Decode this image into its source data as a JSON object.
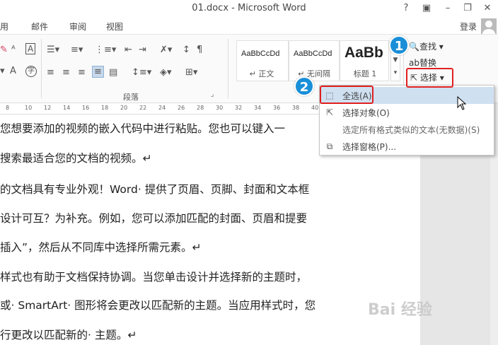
{
  "window": {
    "title": "01.docx - Microsoft Word",
    "help": "?",
    "minimize": "–",
    "close": "✕"
  },
  "menu": {
    "tabs": [
      "用",
      "邮件",
      "审阅",
      "视图"
    ],
    "login": "登录"
  },
  "ribbon": {
    "styles": [
      {
        "sample": "AaBbCcDd",
        "name": "↵ 正文"
      },
      {
        "sample": "AaBbCcDd",
        "name": "↵ 无间隔"
      },
      {
        "sample": "AaBb",
        "name": "标题 1"
      }
    ],
    "paragraph_label": "段落",
    "find_label": "查找",
    "replace_label": "替换",
    "select_label": "选择"
  },
  "ruler": {
    "ticks": [
      "8",
      "10",
      "12",
      "14",
      "16",
      "18",
      "20",
      "22",
      "24",
      "26",
      "28",
      "30",
      "32",
      "34",
      "36",
      "38",
      "40"
    ]
  },
  "document": {
    "lines": [
      "您想要添加的视频的嵌入代码中进行粘贴。您也可以键入一",
      "搜索最适合您的文档的视频。↵",
      "的文档具有专业外观！Word· 提供了页眉、页脚、封面和文本框",
      "设计可互？为补充。例如，您可以添加匹配的封面、页眉和提要",
      "插入”，然后从不同库中选择所需元素。↵",
      "样式也有助于文档保持协调。当您单击设计并选择新的主题时，",
      "或· SmartArt· 图形将会更改以匹配新的主题。当应用样式时，您",
      "行更改以匹配新的· 主题。↵"
    ]
  },
  "dropdown": {
    "items": [
      {
        "icon": "select-all-icon",
        "label": "全选(A)"
      },
      {
        "icon": "select-objects-icon",
        "label": "选择对象(O)"
      },
      {
        "icon": "none",
        "label": "选定所有格式类似的文本(无数据)(S)"
      },
      {
        "icon": "selection-pane-icon",
        "label": "选择窗格(P)..."
      }
    ]
  },
  "annotations": {
    "step1": "1",
    "step2": "2"
  },
  "watermark": "Bai 经验"
}
